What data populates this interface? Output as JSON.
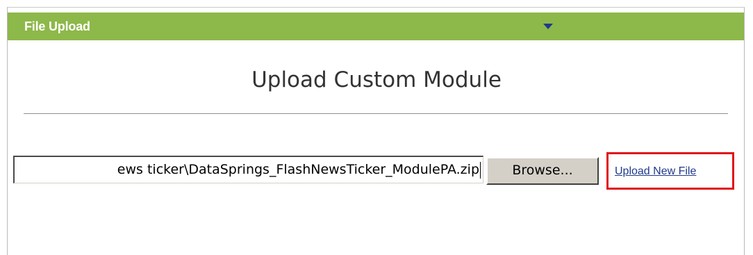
{
  "header": {
    "title": "File Upload",
    "toggle_icon": "triangle-down-icon",
    "background_color": "#8db84a"
  },
  "main": {
    "page_title": "Upload Custom Module",
    "file_input": {
      "value": "ews ticker\\DataSprings_FlashNewsTicker_ModulePA.zip"
    },
    "browse_label": "Browse...",
    "upload_link_label": "Upload New File",
    "highlight_color": "#e0131a"
  }
}
